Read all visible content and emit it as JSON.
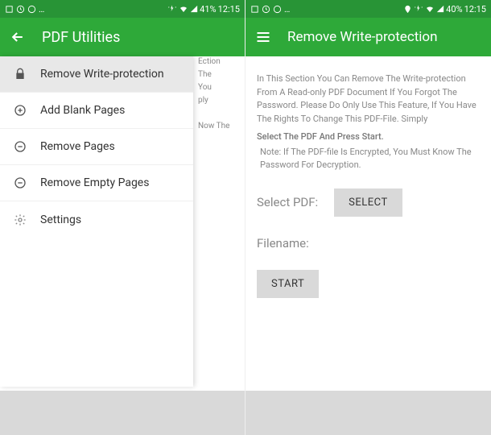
{
  "left": {
    "status": {
      "battery": "41%",
      "time": "12:15"
    },
    "appbar": {
      "title": "PDF Utilities"
    },
    "drawer": {
      "items": [
        {
          "icon": "lock-icon",
          "label": "Remove Write-protection",
          "selected": true
        },
        {
          "icon": "plus-circle-icon",
          "label": "Add Blank Pages",
          "selected": false
        },
        {
          "icon": "minus-circle-icon",
          "label": "Remove Pages",
          "selected": false
        },
        {
          "icon": "minus-circle-icon",
          "label": "Remove Empty Pages",
          "selected": false
        },
        {
          "icon": "gear-icon",
          "label": "Settings",
          "selected": false
        }
      ]
    },
    "bg": {
      "l1": "Ection",
      "l2": "The",
      "l3": "You",
      "l4": "ply",
      "l5": "Now The"
    }
  },
  "right": {
    "status": {
      "battery": "40%",
      "time": "12:15"
    },
    "appbar": {
      "title": "Remove Write-protection"
    },
    "content": {
      "desc1": "In This Section You Can Remove The Write-protection From A Read-only PDF Document If You Forgot The Password. Please Do Only Use This Feature, If You Have The Rights To Change This PDF-File. Simply",
      "desc2": "Select The PDF And Press Start.",
      "note": "Note: If The PDF-file Is Encrypted, You Must Know The Password For Decryption.",
      "select_label": "Select PDF:",
      "select_button": "SELECT",
      "filename_label": "Filename:",
      "start_button": "START"
    }
  }
}
